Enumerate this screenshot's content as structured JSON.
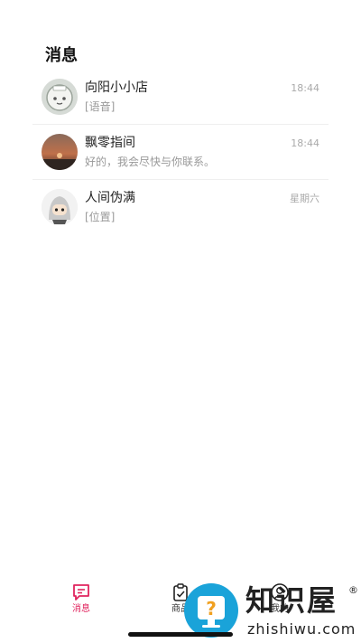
{
  "header": {
    "title": "消息"
  },
  "conversations": [
    {
      "name": "向阳小小店",
      "preview": "[语音]",
      "time": "18:44",
      "avatar_icon": "ghost-sticker-avatar"
    },
    {
      "name": "飘零指间",
      "preview": "好的，我会尽快与你联系。",
      "time": "18:44",
      "avatar_icon": "sunset-photo-avatar"
    },
    {
      "name": "人间伪满",
      "preview": "[位置]",
      "time": "星期六",
      "avatar_icon": "helmet-character-avatar"
    }
  ],
  "tabbar": {
    "active_color": "#e0245e",
    "tabs": [
      {
        "label": "消息",
        "icon": "chat-icon",
        "active": true
      },
      {
        "label": "商品",
        "icon": "clipboard-check-icon",
        "active": false
      },
      {
        "label": "我的",
        "icon": "user-circle-icon",
        "active": false
      }
    ]
  },
  "watermark": {
    "title": "知识屋",
    "reg": "®",
    "url": "zhishiwu.com"
  }
}
